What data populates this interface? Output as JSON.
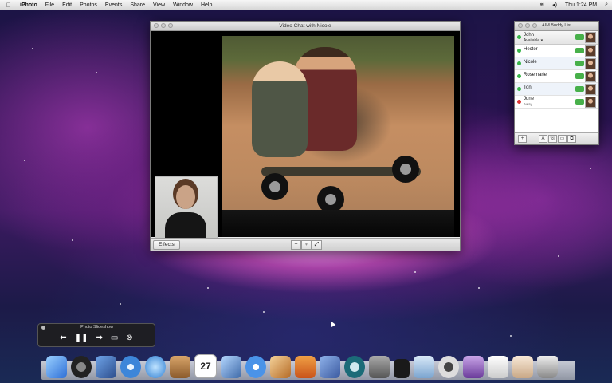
{
  "menubar": {
    "app_name": "iPhoto",
    "items": [
      "File",
      "Edit",
      "Photos",
      "Events",
      "Share",
      "View",
      "Window",
      "Help"
    ],
    "clock": "Thu 1:24 PM"
  },
  "video_chat": {
    "title": "Video Chat with Nicole",
    "effects_label": "Effects",
    "controls": [
      "+",
      "mic",
      "fullscreen"
    ]
  },
  "buddy_list": {
    "title": "AIM Buddy List",
    "me": {
      "name": "John",
      "status": "Available ▾"
    },
    "buddies": [
      {
        "name": "Hector",
        "status": ""
      },
      {
        "name": "Nicole",
        "status": ""
      },
      {
        "name": "Rosemarie",
        "status": ""
      },
      {
        "name": "Toni",
        "status": ""
      },
      {
        "name": "June",
        "status": "Away"
      }
    ],
    "footer_buttons": [
      "+",
      "A",
      "phone",
      "video",
      "screen"
    ]
  },
  "slideshow": {
    "title": "iPhoto Slideshow",
    "controls": [
      "previous",
      "pause",
      "next",
      "display",
      "close"
    ]
  },
  "dock": {
    "calendar_date": "27",
    "icons": [
      "finder-icon",
      "dashboard-icon",
      "mail-icon",
      "safari-icon",
      "ichat-icon",
      "address-book-icon",
      "ical-icon",
      "preview-icon",
      "itunes-icon",
      "iphoto-icon",
      "time-machine-icon",
      "spaces-icon",
      "time-machine-2-icon",
      "system-preferences-icon",
      "photo-booth-icon",
      "photo-icon",
      "ical-2-icon",
      "documents-icon",
      "downloads-icon",
      "trash-icon"
    ]
  }
}
